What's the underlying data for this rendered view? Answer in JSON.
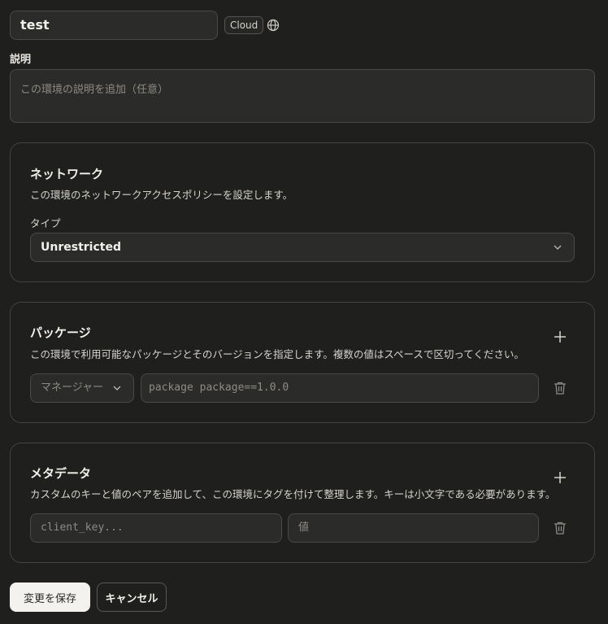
{
  "environment": {
    "name": "test",
    "badge": "Cloud",
    "badge_icon": "globe-icon"
  },
  "description": {
    "label": "説明",
    "placeholder": "この環境の説明を追加（任意）"
  },
  "network": {
    "title": "ネットワーク",
    "subtitle": "この環境のネットワークアクセスポリシーを設定します。",
    "type_label": "タイプ",
    "type_value": "Unrestricted"
  },
  "packages": {
    "title": "パッケージ",
    "subtitle": "この環境で利用可能なパッケージとそのバージョンを指定します。複数の値はスペースで区切ってください。",
    "manager_placeholder": "マネージャー",
    "package_placeholder": "package package==1.0.0",
    "add_icon": "plus-icon",
    "delete_icon": "trash-icon"
  },
  "metadata": {
    "title": "メタデータ",
    "subtitle": "カスタムのキーと値のペアを追加して、この環境にタグを付けて整理します。キーは小文字である必要があります。",
    "key_placeholder": "client_key...",
    "value_placeholder": "値",
    "add_icon": "plus-icon",
    "delete_icon": "trash-icon"
  },
  "actions": {
    "save_label": "変更を保存",
    "cancel_label": "キャンセル"
  }
}
